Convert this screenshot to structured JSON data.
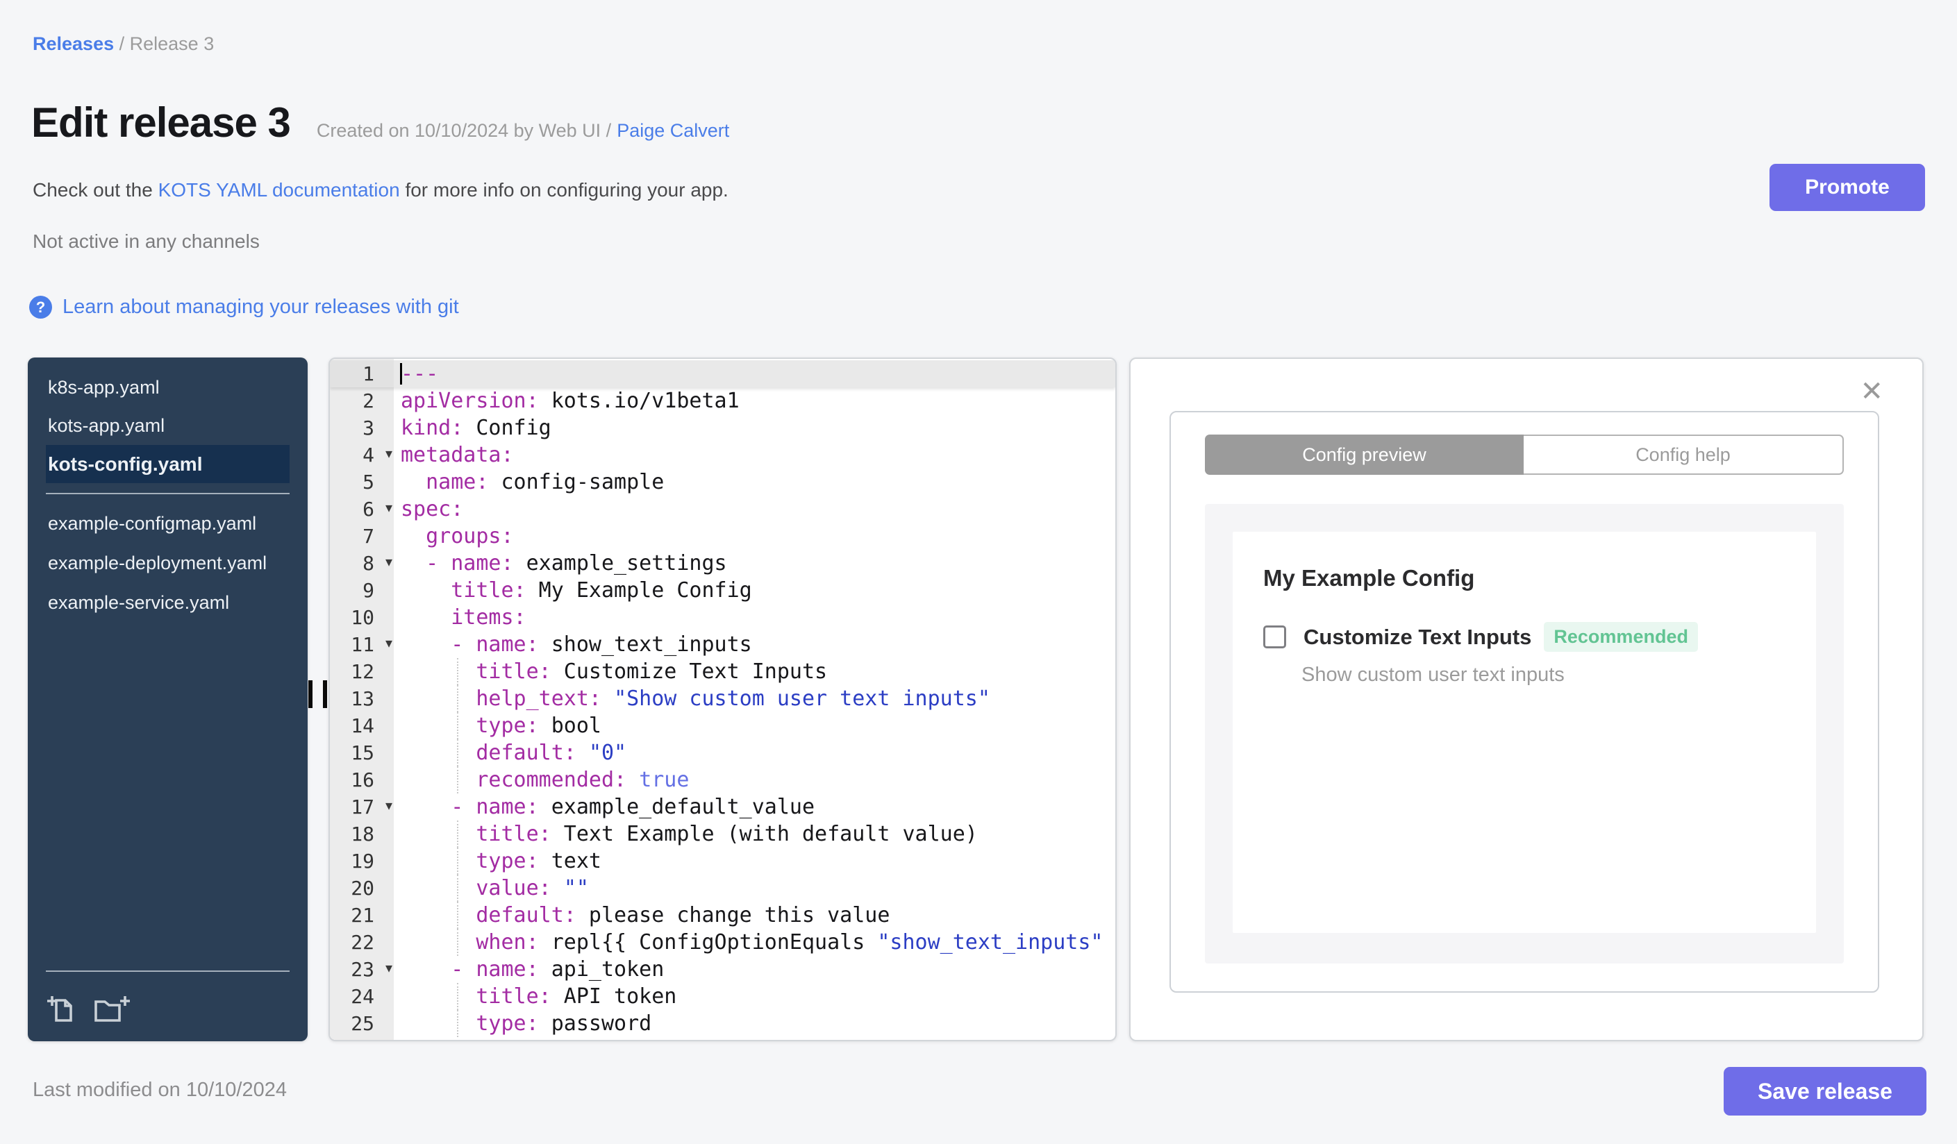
{
  "breadcrumb": {
    "releases": "Releases",
    "sep": " / ",
    "current": "Release 3"
  },
  "header": {
    "title": "Edit release 3",
    "created": "Created on 10/10/2024 by Web UI /",
    "author": "Paige Calvert"
  },
  "intro": {
    "pre": "Check out the ",
    "doc_link": "KOTS YAML documentation",
    "post": " for more info on configuring your app.",
    "status": "Not active in any channels"
  },
  "git_help": {
    "icon": "?",
    "label": "Learn about managing your releases with git"
  },
  "buttons": {
    "promote": "Promote",
    "save": "Save release"
  },
  "footer": {
    "last_modified": "Last modified on 10/10/2024"
  },
  "sidebar": {
    "top_files": [
      {
        "name": "k8s-app.yaml",
        "selected": false
      },
      {
        "name": "kots-app.yaml",
        "selected": false
      },
      {
        "name": "kots-config.yaml",
        "selected": true
      }
    ],
    "bottom_files": [
      {
        "name": "example-configmap.yaml"
      },
      {
        "name": "example-deployment.yaml"
      },
      {
        "name": "example-service.yaml"
      }
    ],
    "icons": [
      "add-file",
      "add-folder"
    ]
  },
  "editor": {
    "lines": [
      {
        "n": 1,
        "active": true,
        "cursor": true,
        "tokens": [
          {
            "c": "key",
            "x": "---"
          }
        ]
      },
      {
        "n": 2,
        "tokens": [
          {
            "c": "key",
            "x": "apiVersion:"
          },
          {
            "c": "val",
            "x": " kots.io/v1beta1"
          }
        ]
      },
      {
        "n": 3,
        "tokens": [
          {
            "c": "key",
            "x": "kind:"
          },
          {
            "c": "val",
            "x": " Config"
          }
        ]
      },
      {
        "n": 4,
        "fold": true,
        "tokens": [
          {
            "c": "key",
            "x": "metadata:"
          }
        ]
      },
      {
        "n": 5,
        "tokens": [
          {
            "c": "val",
            "x": "  "
          },
          {
            "c": "key",
            "x": "name:"
          },
          {
            "c": "val",
            "x": " config-sample"
          }
        ]
      },
      {
        "n": 6,
        "fold": true,
        "tokens": [
          {
            "c": "key",
            "x": "spec:"
          }
        ]
      },
      {
        "n": 7,
        "tokens": [
          {
            "c": "val",
            "x": "  "
          },
          {
            "c": "key",
            "x": "groups:"
          }
        ]
      },
      {
        "n": 8,
        "fold": true,
        "tokens": [
          {
            "c": "val",
            "x": "  "
          },
          {
            "c": "key",
            "x": "- name:"
          },
          {
            "c": "val",
            "x": " example_settings"
          }
        ]
      },
      {
        "n": 9,
        "tokens": [
          {
            "c": "val",
            "x": "    "
          },
          {
            "c": "key",
            "x": "title:"
          },
          {
            "c": "val",
            "x": " My Example Config"
          }
        ]
      },
      {
        "n": 10,
        "tokens": [
          {
            "c": "val",
            "x": "    "
          },
          {
            "c": "key",
            "x": "items:"
          }
        ]
      },
      {
        "n": 11,
        "fold": true,
        "tokens": [
          {
            "c": "val",
            "x": "    "
          },
          {
            "c": "key",
            "x": "- name:"
          },
          {
            "c": "val",
            "x": " show_text_inputs"
          }
        ]
      },
      {
        "n": 12,
        "guide": true,
        "tokens": [
          {
            "c": "val",
            "x": "      "
          },
          {
            "c": "key",
            "x": "title:"
          },
          {
            "c": "val",
            "x": " Customize Text Inputs"
          }
        ]
      },
      {
        "n": 13,
        "guide": true,
        "tokens": [
          {
            "c": "val",
            "x": "      "
          },
          {
            "c": "key",
            "x": "help_text:"
          },
          {
            "c": "val",
            "x": " "
          },
          {
            "c": "str",
            "x": "\"Show custom user text inputs\""
          }
        ]
      },
      {
        "n": 14,
        "guide": true,
        "tokens": [
          {
            "c": "val",
            "x": "      "
          },
          {
            "c": "key",
            "x": "type:"
          },
          {
            "c": "val",
            "x": " bool"
          }
        ]
      },
      {
        "n": 15,
        "guide": true,
        "tokens": [
          {
            "c": "val",
            "x": "      "
          },
          {
            "c": "key",
            "x": "default:"
          },
          {
            "c": "val",
            "x": " "
          },
          {
            "c": "str",
            "x": "\"0\""
          }
        ]
      },
      {
        "n": 16,
        "guide": true,
        "tokens": [
          {
            "c": "val",
            "x": "      "
          },
          {
            "c": "key",
            "x": "recommended:"
          },
          {
            "c": "val",
            "x": " "
          },
          {
            "c": "bool",
            "x": "true"
          }
        ]
      },
      {
        "n": 17,
        "fold": true,
        "tokens": [
          {
            "c": "val",
            "x": "    "
          },
          {
            "c": "key",
            "x": "- name:"
          },
          {
            "c": "val",
            "x": " example_default_value"
          }
        ]
      },
      {
        "n": 18,
        "guide": true,
        "tokens": [
          {
            "c": "val",
            "x": "      "
          },
          {
            "c": "key",
            "x": "title:"
          },
          {
            "c": "val",
            "x": " Text Example (with default value)"
          }
        ]
      },
      {
        "n": 19,
        "guide": true,
        "tokens": [
          {
            "c": "val",
            "x": "      "
          },
          {
            "c": "key",
            "x": "type:"
          },
          {
            "c": "val",
            "x": " text"
          }
        ]
      },
      {
        "n": 20,
        "guide": true,
        "tokens": [
          {
            "c": "val",
            "x": "      "
          },
          {
            "c": "key",
            "x": "value:"
          },
          {
            "c": "val",
            "x": " "
          },
          {
            "c": "str",
            "x": "\"\""
          }
        ]
      },
      {
        "n": 21,
        "guide": true,
        "tokens": [
          {
            "c": "val",
            "x": "      "
          },
          {
            "c": "key",
            "x": "default:"
          },
          {
            "c": "val",
            "x": " please change this value"
          }
        ]
      },
      {
        "n": 22,
        "guide": true,
        "tokens": [
          {
            "c": "val",
            "x": "      "
          },
          {
            "c": "key",
            "x": "when:"
          },
          {
            "c": "val",
            "x": " repl{{ ConfigOptionEquals "
          },
          {
            "c": "str",
            "x": "\"show_text_inputs\""
          }
        ]
      },
      {
        "n": 23,
        "fold": true,
        "tokens": [
          {
            "c": "val",
            "x": "    "
          },
          {
            "c": "key",
            "x": "- name:"
          },
          {
            "c": "val",
            "x": " api_token"
          }
        ]
      },
      {
        "n": 24,
        "guide": true,
        "tokens": [
          {
            "c": "val",
            "x": "      "
          },
          {
            "c": "key",
            "x": "title:"
          },
          {
            "c": "val",
            "x": " API token"
          }
        ]
      },
      {
        "n": 25,
        "guide": true,
        "tokens": [
          {
            "c": "val",
            "x": "      "
          },
          {
            "c": "key",
            "x": "type:"
          },
          {
            "c": "val",
            "x": " password"
          }
        ]
      }
    ]
  },
  "config_panel": {
    "close_icon": "✕",
    "tabs": [
      {
        "label": "Config preview",
        "active": true
      },
      {
        "label": "Config help",
        "active": false
      }
    ],
    "group_title": "My Example Config",
    "item": {
      "label": "Customize Text Inputs",
      "badge": "Recommended",
      "help_text": "Show custom user text inputs",
      "checked": false
    }
  },
  "colors": {
    "page-bg": "#f5f6f8",
    "accent": "#6f6de8",
    "link": "#4a7de8",
    "sidebar-bg": "#2b3f56",
    "sidebar-selected": "#16304f",
    "code-key": "#a32ca3",
    "code-str": "#2c3ec4",
    "code-bool": "#6470e4",
    "badge-text": "#62c493",
    "badge-bg": "#e9f7f0"
  }
}
